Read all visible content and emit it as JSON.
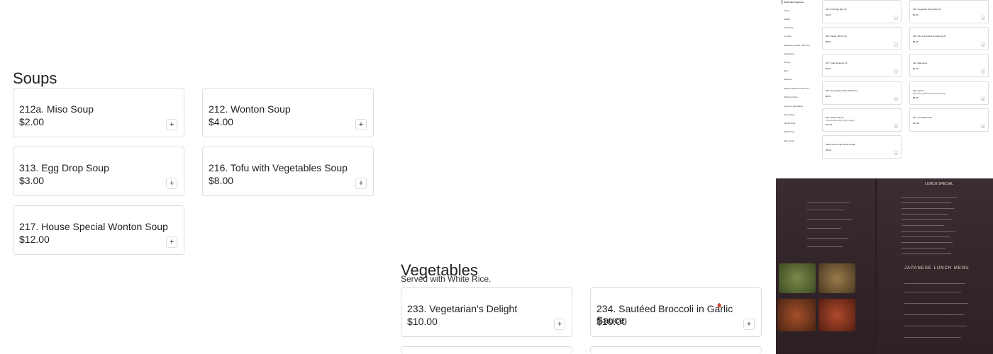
{
  "soups": {
    "title": "Soups",
    "items": [
      {
        "name": "212a. Miso Soup",
        "price": "$2.00"
      },
      {
        "name": "212. Wonton Soup",
        "price": "$4.00"
      },
      {
        "name": "313. Egg Drop Soup",
        "price": "$3.00"
      },
      {
        "name": "216. Tofu with Vegetables Soup",
        "price": "$8.00"
      },
      {
        "name": "217. House Special Wonton Soup",
        "price": "$12.00"
      }
    ]
  },
  "vegetables": {
    "title": "Vegetables",
    "subtitle": "Served with White Rice.",
    "items": [
      {
        "name": "233. Vegetarian's Delight",
        "price": "$10.00",
        "spicy": false
      },
      {
        "name": "234. Sautéed Broccoli in Garlic Sauce",
        "price": "$10.00",
        "spicy": true
      }
    ]
  },
  "add_label": "+",
  "mini": {
    "categories": [
      "Sushi Bar Appetizer",
      "Soups",
      "Salads",
      "Fried Rice",
      "Lo Mein",
      "Japanese Noodle / Mei Fun",
      "Vegetables",
      "Poultry",
      "Beef",
      "Seafood",
      "Weight Watchers Selection",
      "Kitchen Entrée",
      "Gourmet Specialties",
      "Kutsu Menu",
      "Family Meal",
      "Party Trays",
      "Side Order"
    ],
    "items": [
      {
        "name": "201. Pork Egg Roll (2)",
        "desc": "",
        "price": "$3.00"
      },
      {
        "name": "202. Vegetable Spring Roll (2)",
        "desc": "",
        "price": "$2.50"
      },
      {
        "name": "204. Panko Shrimp (5)",
        "desc": "",
        "price": "$5.50"
      },
      {
        "name": "206. Pan Fried Meat Dumplings (6)",
        "desc": "",
        "price": "$5.95"
      },
      {
        "name": "207. Crab Rangoon (6)",
        "desc": "",
        "price": "$6.00"
      },
      {
        "name": "210. Edamame",
        "desc": "",
        "price": "$4.00"
      },
      {
        "name": "208. Angry Spicy Garlic Edamame",
        "desc": "",
        "price": "$8.00"
      },
      {
        "name": "229. Gyoza",
        "desc": "Pan fried, japanese pork dumpling",
        "price": "$5.95"
      },
      {
        "name": "230. Rocky Shrimp",
        "desc": "Fried shrimp with spicy mango",
        "price": "$12.00"
      },
      {
        "name": "234. Soft Shell Crab",
        "desc": "",
        "price": "$13.00"
      },
      {
        "name": "234a. Deep Fried Sweet Potato",
        "desc": "",
        "price": "$5.00"
      }
    ]
  },
  "photo": {
    "lunch_header": "LUNCH SPECIAL",
    "japanese_title": "JAPANESE LUNCH MENU"
  }
}
